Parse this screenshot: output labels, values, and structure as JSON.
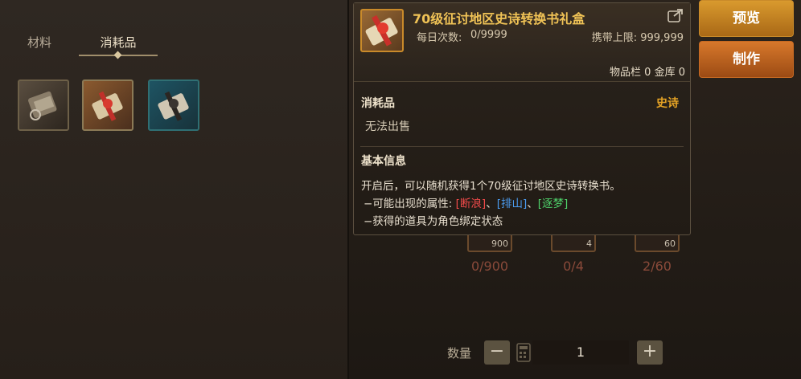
{
  "tabs": {
    "materials": "材料",
    "consumables": "消耗品"
  },
  "buttons": {
    "preview": "预览",
    "craft": "制作"
  },
  "tooltip": {
    "title": "70级征讨地区史诗转换书礼盒",
    "daily_label": "每日次数:",
    "daily_value": "0/9999",
    "carry_limit": "携带上限: 999,999",
    "storage": "物品栏 0 金库 0",
    "type": "消耗品",
    "grade": "史诗",
    "sell": "无法出售",
    "info_heading": "基本信息",
    "desc": "开启后，可以随机获得1个70级征讨地区史诗转换书。",
    "attrs_prefix": "−可能出现的属性: ",
    "attr_1": "[断浪]",
    "sep_1": "、",
    "attr_2": "[排山]",
    "sep_2": "、",
    "attr_3": "[逐梦]",
    "bind": "−获得的道具为角色绑定状态",
    "colors": {
      "title": "#f0c356",
      "grade": "#e5a325",
      "attr_1": "#f14a4a",
      "attr_2": "#4b9cf0",
      "attr_3": "#4fd36b"
    }
  },
  "materials": [
    {
      "badge": "900",
      "count": "0/900"
    },
    {
      "badge": "4",
      "count": "0/4"
    },
    {
      "badge": "60",
      "count": "2/60"
    }
  ],
  "quantity": {
    "label": "数量",
    "minus": "−",
    "plus": "+",
    "value": "1"
  },
  "icons": [
    "gift-box-icon",
    "share-icon",
    "calculator-icon",
    "minus-icon",
    "plus-icon"
  ]
}
